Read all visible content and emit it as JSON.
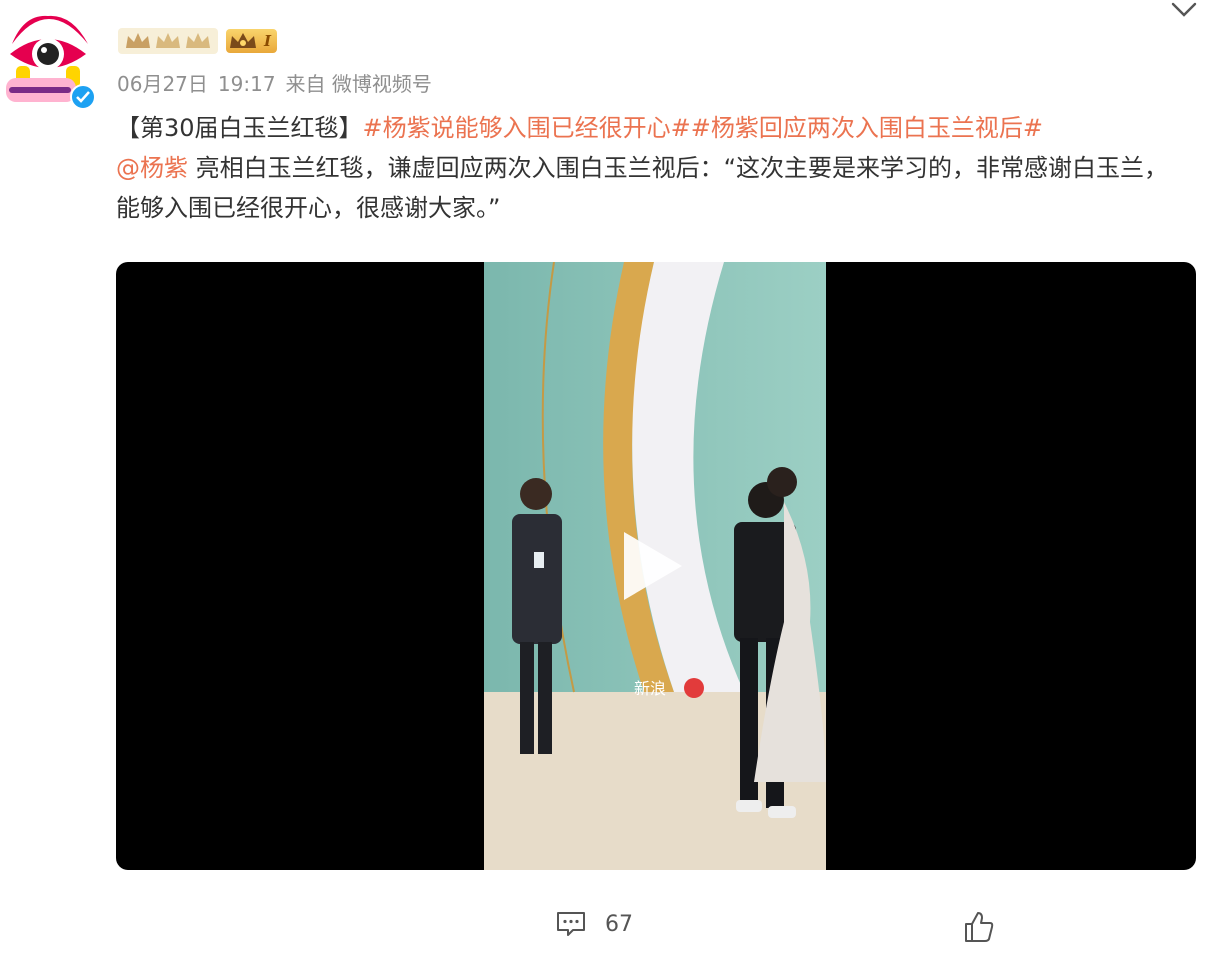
{
  "post": {
    "level_label": "I",
    "date": "06月27日",
    "time": "19:17",
    "source": "来自 微博视频号",
    "text_bracket": "【第30届白玉兰红毯】",
    "hashtag1": "#杨紫说能够入围已经很开心#",
    "hashtag2": "#杨紫回应两次入围白玉兰视后#",
    "mention": "@杨紫",
    "body_after_mention": " 亮相白玉兰红毯，谦虚回应两次入围白玉兰视后：“这次主要是来学习的，非常感谢白玉兰，能够入围已经很开心，很感谢大家。”",
    "video_watermark": "新浪"
  },
  "actions": {
    "comments_count": "67"
  },
  "colors": {
    "link": "#eb7350",
    "meta": "#8f8f8f",
    "verified": "#1da1f2"
  },
  "icons": {
    "avatar": "sina-entertainment-avatar",
    "verified": "verified-badge-icon",
    "crown": "crown-icon",
    "chevron": "chevron-down-icon",
    "play": "play-icon",
    "comment": "comment-icon",
    "like": "thumbs-up-icon"
  }
}
